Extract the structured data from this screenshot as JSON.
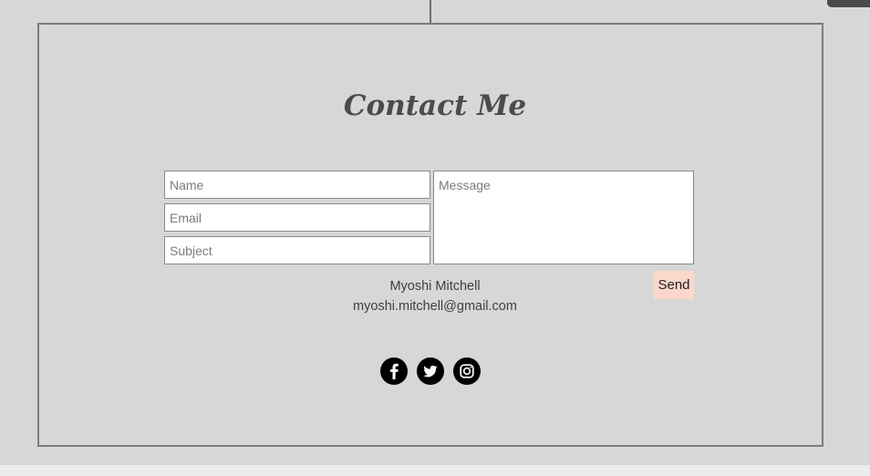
{
  "contact": {
    "title": "Contact Me",
    "form": {
      "name_placeholder": "Name",
      "email_placeholder": "Email",
      "subject_placeholder": "Subject",
      "message_placeholder": "Message",
      "send_label": "Send"
    },
    "person_name": "Myoshi Mitchell",
    "person_email": "myoshi.mitchell@gmail.com"
  },
  "social": {
    "icons": [
      "facebook-icon",
      "twitter-icon",
      "instagram-icon"
    ]
  },
  "colors": {
    "background": "#d7d7d7",
    "frame_border": "#7c7c7c",
    "send_button": "#fcd7cc",
    "social_icon": "#000000"
  }
}
